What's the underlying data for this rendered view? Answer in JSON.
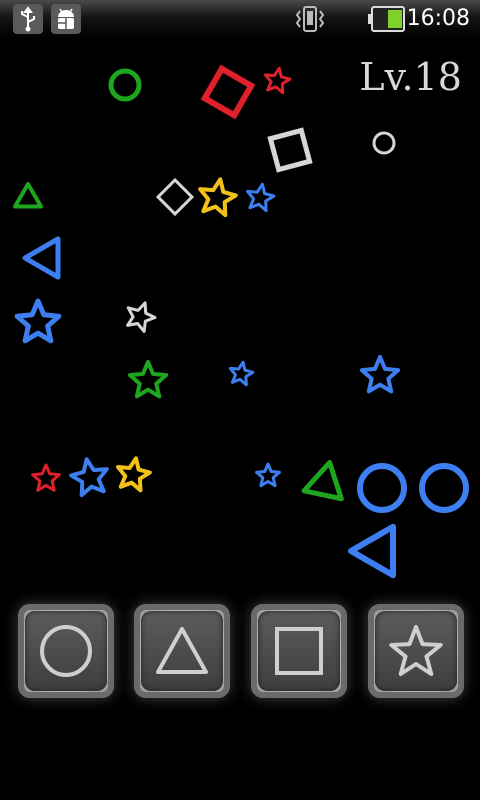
{
  "status_bar": {
    "time": "16:08",
    "icons": [
      "usb-icon",
      "android-debug-icon",
      "vibrate-icon",
      "battery-icon"
    ],
    "battery_color": "#7fd12a"
  },
  "game": {
    "level_text": "Lv.18",
    "colors": {
      "green": "#1fa61f",
      "red": "#e0202b",
      "white": "#d6d6d6",
      "blue": "#3d7ff0",
      "yellow": "#f2c21a"
    },
    "shapes": [
      {
        "kind": "circle",
        "color": "green",
        "size": "small"
      },
      {
        "kind": "square",
        "color": "red",
        "size": "medium"
      },
      {
        "kind": "star",
        "color": "red",
        "size": "small"
      },
      {
        "kind": "square",
        "color": "white",
        "size": "medium"
      },
      {
        "kind": "circle",
        "color": "white",
        "size": "small"
      },
      {
        "kind": "triangle",
        "color": "green",
        "size": "small"
      },
      {
        "kind": "diamond",
        "color": "white",
        "size": "small"
      },
      {
        "kind": "star",
        "color": "yellow",
        "size": "medium"
      },
      {
        "kind": "star",
        "color": "blue",
        "size": "small"
      },
      {
        "kind": "triangle",
        "color": "blue",
        "size": "medium"
      },
      {
        "kind": "star",
        "color": "blue",
        "size": "medium"
      },
      {
        "kind": "star",
        "color": "white",
        "size": "small"
      },
      {
        "kind": "star",
        "color": "green",
        "size": "medium"
      },
      {
        "kind": "star",
        "color": "blue",
        "size": "small"
      },
      {
        "kind": "star",
        "color": "blue",
        "size": "medium"
      },
      {
        "kind": "star",
        "color": "red",
        "size": "small"
      },
      {
        "kind": "star",
        "color": "blue",
        "size": "medium"
      },
      {
        "kind": "star",
        "color": "yellow",
        "size": "medium"
      },
      {
        "kind": "star",
        "color": "blue",
        "size": "small"
      },
      {
        "kind": "triangle",
        "color": "green",
        "size": "medium"
      },
      {
        "kind": "circle",
        "color": "blue",
        "size": "large"
      },
      {
        "kind": "circle",
        "color": "blue",
        "size": "large"
      },
      {
        "kind": "triangle",
        "color": "blue",
        "size": "large"
      }
    ]
  },
  "controls": [
    {
      "name": "circle-button",
      "icon": "circle-icon"
    },
    {
      "name": "triangle-button",
      "icon": "triangle-icon"
    },
    {
      "name": "square-button",
      "icon": "square-icon"
    },
    {
      "name": "star-button",
      "icon": "star-icon"
    }
  ]
}
